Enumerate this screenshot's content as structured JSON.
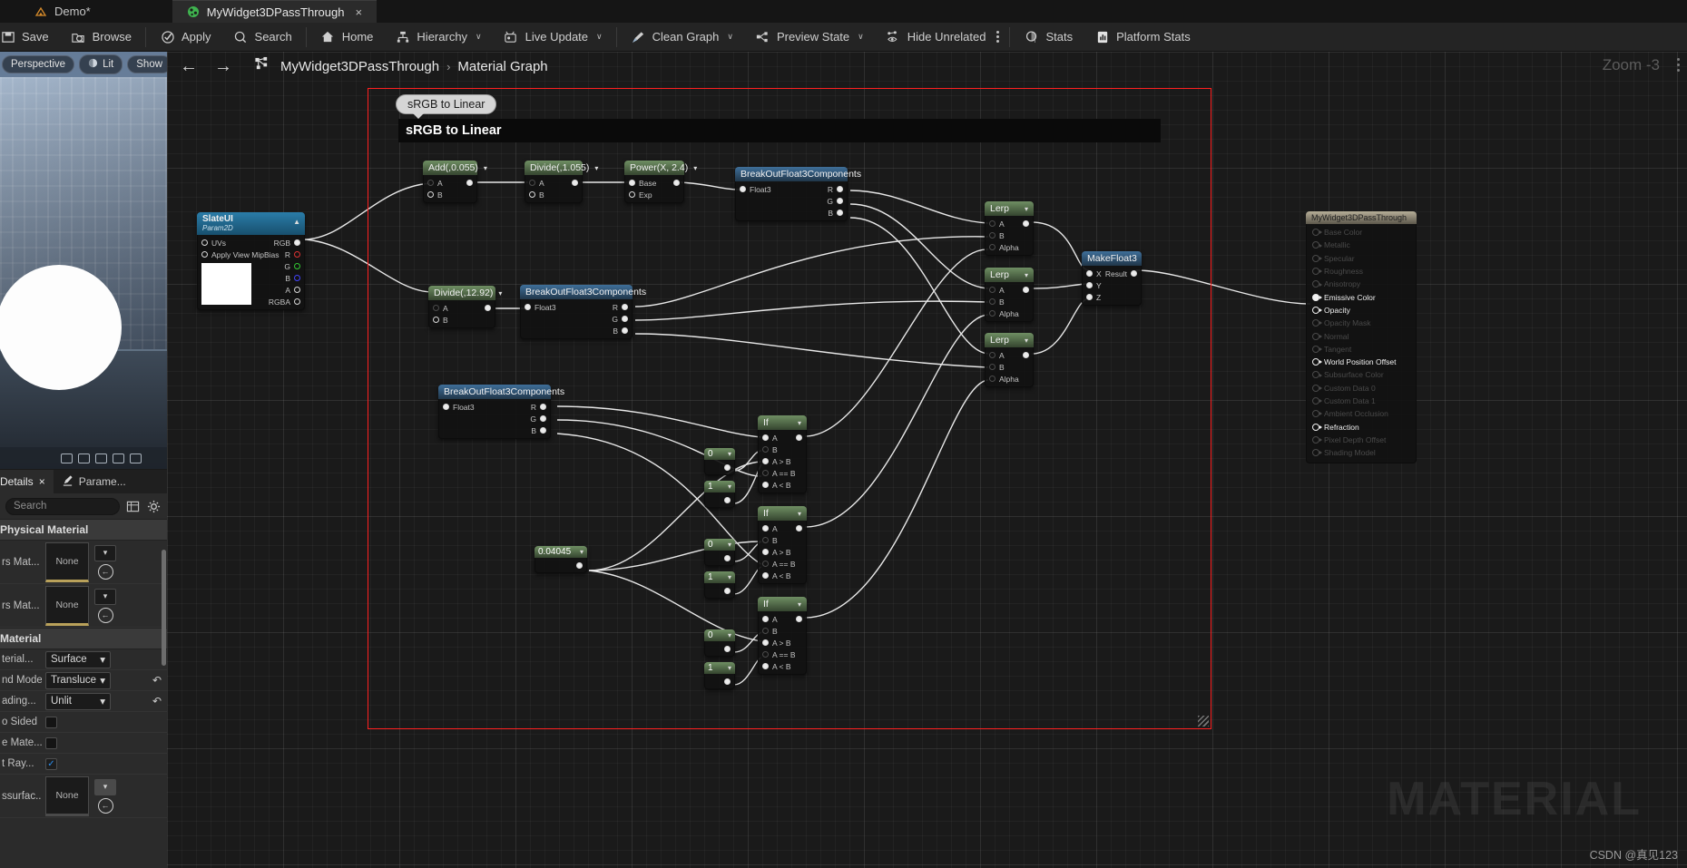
{
  "tabs": [
    {
      "label": "Demo*",
      "icon": "unreal-logo-icon",
      "active": false,
      "closable": false
    },
    {
      "label": "MyWidget3DPassThrough",
      "icon": "material-sphere-icon",
      "active": true,
      "closable": true,
      "close": "×"
    }
  ],
  "toolbar": {
    "items": [
      {
        "label": "Save",
        "icon": "save-icon",
        "caret": ""
      },
      {
        "label": "Browse",
        "icon": "browse-icon",
        "caret": ""
      },
      {
        "label": "Apply",
        "icon": "apply-check-icon",
        "caret": ""
      },
      {
        "label": "Search",
        "icon": "search-icon",
        "caret": ""
      },
      {
        "label": "Home",
        "icon": "home-icon",
        "caret": ""
      },
      {
        "label": "Hierarchy",
        "icon": "hierarchy-icon",
        "caret": "∨"
      },
      {
        "label": "Live Update",
        "icon": "live-update-icon",
        "caret": "∨"
      },
      {
        "label": "Clean Graph",
        "icon": "clean-graph-brush-icon",
        "caret": "∨"
      },
      {
        "label": "Preview State",
        "icon": "preview-state-icon",
        "caret": "∨"
      },
      {
        "label": "Hide Unrelated",
        "icon": "hide-unrelated-eye-icon",
        "caret": ""
      },
      {
        "label": "Stats",
        "icon": "stats-icon",
        "caret": ""
      },
      {
        "label": "Platform Stats",
        "icon": "platform-stats-icon",
        "caret": ""
      }
    ]
  },
  "viewport": {
    "perspective_label": "Perspective",
    "lit_label": "Lit",
    "show_label": "Show"
  },
  "graph": {
    "back_icon": "arrow-left-icon",
    "forward_icon": "arrow-right-icon",
    "graph_icon": "node-graph-icon",
    "breadcrumb": [
      "MyWidget3DPassThrough",
      "Material Graph"
    ],
    "separator": "›",
    "zoom_label": "Zoom -3",
    "watermark": "MATERIAL",
    "credit": "CSDN @真见123"
  },
  "comment": {
    "bubble": "sRGB to Linear",
    "title": "sRGB to Linear"
  },
  "nodes": {
    "slateui": {
      "title": "SlateUI",
      "subtitle": "Param2D",
      "inputs": [
        "UVs",
        "Apply View MipBias"
      ],
      "outputs": [
        "RGB",
        "R",
        "G",
        "B",
        "A",
        "RGBA"
      ]
    },
    "add": {
      "title": "Add(,0.055)",
      "inputs": [
        "A",
        "B"
      ]
    },
    "divide1055": {
      "title": "Divide(,1.055)",
      "inputs": [
        "A",
        "B"
      ]
    },
    "power": {
      "title": "Power(X, 2.4)",
      "inputs": [
        "Base",
        "Exp"
      ]
    },
    "divide1292": {
      "title": "Divide(,12.92)",
      "inputs": [
        "A",
        "B"
      ]
    },
    "break1": {
      "title": "BreakOutFloat3Components",
      "input": "Float3",
      "outputs": [
        "R",
        "G",
        "B"
      ]
    },
    "break2": {
      "title": "BreakOutFloat3Components",
      "input": "Float3",
      "outputs": [
        "R",
        "G",
        "B"
      ]
    },
    "break3": {
      "title": "BreakOutFloat3Components",
      "input": "Float3",
      "outputs": [
        "R",
        "G",
        "B"
      ]
    },
    "lerp": {
      "title": "Lerp",
      "inputs": [
        "A",
        "B",
        "Alpha"
      ]
    },
    "makefloat3": {
      "title": "MakeFloat3",
      "inputs": [
        "X",
        "Y",
        "Z"
      ],
      "output": "Result"
    },
    "ifnode": {
      "title": "If",
      "inputs": [
        "A",
        "B",
        "A > B",
        "A == B",
        "A < B"
      ]
    },
    "const0": {
      "value": "0"
    },
    "const1": {
      "value": "1"
    },
    "const004045": {
      "value": "0.04045"
    }
  },
  "output_node": {
    "title": "MyWidget3DPassThrough",
    "pins": [
      {
        "label": "Base Color",
        "active": false
      },
      {
        "label": "Metallic",
        "active": false
      },
      {
        "label": "Specular",
        "active": false
      },
      {
        "label": "Roughness",
        "active": false
      },
      {
        "label": "Anisotropy",
        "active": false
      },
      {
        "label": "Emissive Color",
        "active": true,
        "connected": true
      },
      {
        "label": "Opacity",
        "active": true
      },
      {
        "label": "Opacity Mask",
        "active": false
      },
      {
        "label": "Normal",
        "active": false
      },
      {
        "label": "Tangent",
        "active": false
      },
      {
        "label": "World Position Offset",
        "active": true
      },
      {
        "label": "Subsurface Color",
        "active": false
      },
      {
        "label": "Custom Data 0",
        "active": false
      },
      {
        "label": "Custom Data 1",
        "active": false
      },
      {
        "label": "Ambient Occlusion",
        "active": false
      },
      {
        "label": "Refraction",
        "active": true
      },
      {
        "label": "Pixel Depth Offset",
        "active": false
      },
      {
        "label": "Shading Model",
        "active": false
      }
    ]
  },
  "details_panel": {
    "tabs": [
      {
        "label": "Details",
        "icon": "details-icon",
        "selected": true,
        "close": "×"
      },
      {
        "label": "Parame...",
        "icon": "parameters-pencil-icon",
        "selected": false
      }
    ],
    "search_placeholder": "Search",
    "grid_icon": "grid-view-icon",
    "settings_icon": "gear-icon",
    "sections": [
      {
        "title": "Physical Material",
        "rows": [
          {
            "label": "rs Mat...",
            "type": "asset",
            "value": "None"
          },
          {
            "label": "rs Mat...",
            "type": "asset",
            "value": "None"
          }
        ]
      },
      {
        "title": "Material",
        "rows": [
          {
            "label": "terial...",
            "type": "combo",
            "value": "Surface"
          },
          {
            "label": "nd Mode",
            "type": "combo",
            "value": "Transluce",
            "reset": true
          },
          {
            "label": "ading...",
            "type": "combo",
            "value": "Unlit",
            "reset": true
          },
          {
            "label": "o Sided",
            "type": "checkbox",
            "checked": false
          },
          {
            "label": "e Mate...",
            "type": "checkbox",
            "checked": false
          },
          {
            "label": "t Ray...",
            "type": "checkbox",
            "checked": true
          },
          {
            "label": "ssurfac...",
            "type": "asset",
            "value": "None"
          }
        ]
      }
    ]
  },
  "colors": {
    "accent_red": "#ff2020",
    "node_green": "#6f8f63",
    "node_blue": "#3f6f9a",
    "node_tan": "#b6ae98"
  }
}
